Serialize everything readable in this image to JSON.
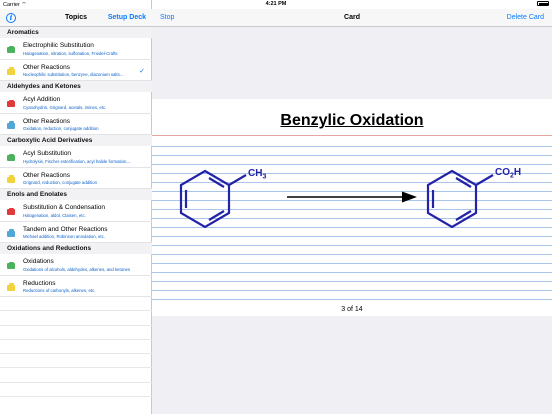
{
  "status": {
    "carrier": "Carrier",
    "time": "4:21 PM"
  },
  "left_nav": {
    "title": "Topics",
    "setup_label": "Setup Deck"
  },
  "sections": [
    {
      "header": "Aromatics",
      "items": [
        {
          "title": "Electrophilic Substitution",
          "subtitle": "Halogenation, nitration, sulfonation, Friedel-Crafts",
          "color": "#4cb25b",
          "checked": false
        },
        {
          "title": "Other Reactions",
          "subtitle": "Nucleophilic substitution, benzyne, diazonium salts...",
          "color": "#f2d33a",
          "checked": true
        }
      ]
    },
    {
      "header": "Aldehydes and Ketones",
      "items": [
        {
          "title": "Acyl Addition",
          "subtitle": "Cyanohydrin, Grignard, acetals, imines, etc.",
          "color": "#e03a3a",
          "checked": false
        },
        {
          "title": "Other Reactions",
          "subtitle": "Oxidation, reduction, conjugate addition",
          "color": "#4fa8d8",
          "checked": false
        }
      ]
    },
    {
      "header": "Carboxylic Acid Derivatives",
      "items": [
        {
          "title": "Acyl Substitution",
          "subtitle": "Hydrolysis, Fischer esterification, acyl halide formation,...",
          "color": "#4cb25b",
          "checked": false
        },
        {
          "title": "Other Reactions",
          "subtitle": "Grignard, reduction, conjugate addition",
          "color": "#f2d33a",
          "checked": false
        }
      ]
    },
    {
      "header": "Enols and Enolates",
      "items": [
        {
          "title": "Substitution & Condensation",
          "subtitle": "Halogenation, aldol, Claisen, etc.",
          "color": "#e03a3a",
          "checked": false
        },
        {
          "title": "Tandem and Other Reactions",
          "subtitle": "Michael addition, Robinson annulation, etc.",
          "color": "#4fa8d8",
          "checked": false
        }
      ]
    },
    {
      "header": "Oxidations and Reductions",
      "items": [
        {
          "title": "Oxidations",
          "subtitle": "Oxidations of alcohols, aldehydes, alkenes, and ketones",
          "color": "#4cb25b",
          "checked": false
        },
        {
          "title": "Reductions",
          "subtitle": "Reductions of carbonyls, alkenes, etc.",
          "color": "#f2d33a",
          "checked": false
        }
      ]
    }
  ],
  "right_nav": {
    "stop_label": "Stop",
    "title": "Card",
    "delete_label": "Delete Card"
  },
  "card": {
    "title": "Benzylic Oxidation",
    "reactant_group": "CH3",
    "product_group": "CO2H",
    "counter": "3 of 14"
  },
  "colors": {
    "accent": "#0a7aff",
    "structure": "#2323a8"
  }
}
